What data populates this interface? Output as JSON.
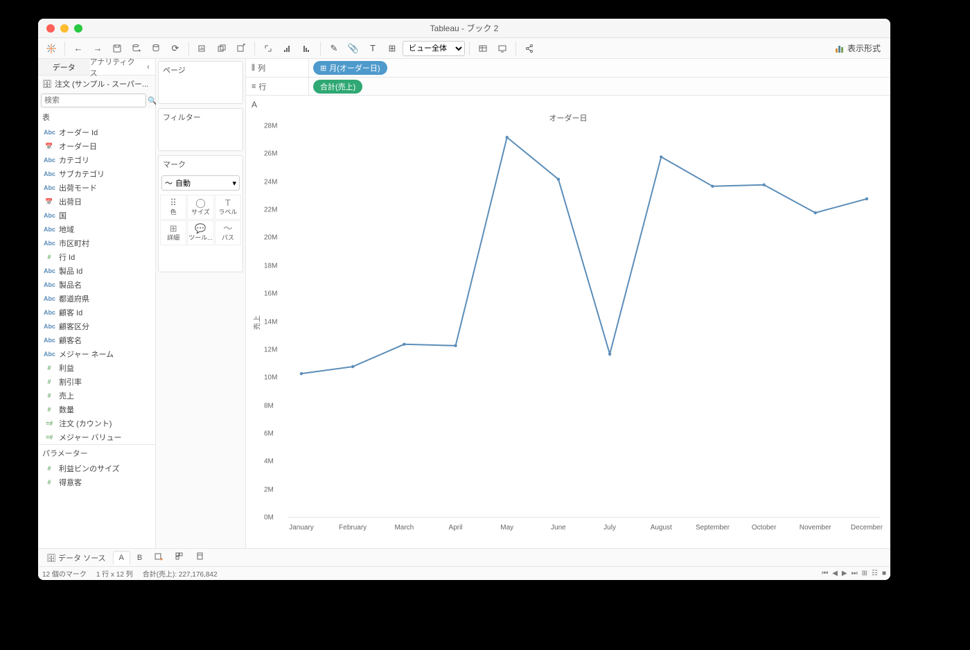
{
  "window": {
    "title": "Tableau - ブック 2"
  },
  "toolbar": {
    "fit_select": "ビュー全体",
    "showme_label": "表示形式"
  },
  "left": {
    "tabs": {
      "data": "データ",
      "analytics": "アナリティクス"
    },
    "datasource": "注文 (サンプル - スーパー...",
    "search_placeholder": "検索",
    "table_header": "表",
    "fields": [
      {
        "icon": "abc",
        "label": "オーダー Id"
      },
      {
        "icon": "date",
        "label": "オーダー日"
      },
      {
        "icon": "abc",
        "label": "カテゴリ"
      },
      {
        "icon": "abc",
        "label": "サブカテゴリ"
      },
      {
        "icon": "abc",
        "label": "出荷モード"
      },
      {
        "icon": "date",
        "label": "出荷日"
      },
      {
        "icon": "abc",
        "label": "国"
      },
      {
        "icon": "abc",
        "label": "地域"
      },
      {
        "icon": "abc",
        "label": "市区町村"
      },
      {
        "icon": "num",
        "label": "行 Id"
      },
      {
        "icon": "abc",
        "label": "製品 Id"
      },
      {
        "icon": "abc",
        "label": "製品名"
      },
      {
        "icon": "abc",
        "label": "都道府県"
      },
      {
        "icon": "abc",
        "label": "顧客 Id"
      },
      {
        "icon": "abc",
        "label": "顧客区分"
      },
      {
        "icon": "abc",
        "label": "顧客名"
      },
      {
        "icon": "abc",
        "label": "メジャー ネーム"
      },
      {
        "icon": "num",
        "label": "利益"
      },
      {
        "icon": "num",
        "label": "割引率"
      },
      {
        "icon": "num",
        "label": "売上"
      },
      {
        "icon": "num",
        "label": "数量"
      },
      {
        "icon": "numi",
        "label": "注文 (カウント)"
      },
      {
        "icon": "numi",
        "label": "メジャー バリュー"
      }
    ],
    "param_header": "パラメーター",
    "params": [
      {
        "label": "利益ビンのサイズ"
      },
      {
        "label": "得意客"
      }
    ]
  },
  "cards": {
    "pages": "ページ",
    "filters": "フィルター",
    "marks": "マーク",
    "marktype": "自動",
    "cells": {
      "color": "色",
      "size": "サイズ",
      "label": "ラベル",
      "detail": "詳細",
      "tooltip": "ツール...",
      "path": "パス"
    }
  },
  "shelves": {
    "columns_label": "列",
    "rows_label": "行",
    "column_pill": "月(オーダー日)",
    "row_pill": "合計(売上)"
  },
  "viz": {
    "corner": "A",
    "chart_title": "オーダー日",
    "ylabel": "売上"
  },
  "chart_data": {
    "type": "line",
    "categories": [
      "January",
      "February",
      "March",
      "April",
      "May",
      "June",
      "July",
      "August",
      "September",
      "October",
      "November",
      "December"
    ],
    "values": [
      10300000,
      10800000,
      12400000,
      12300000,
      27200000,
      24200000,
      11700000,
      25800000,
      23700000,
      23800000,
      21800000,
      22800000
    ],
    "xlabel": "",
    "ylabel": "売上",
    "ylim": [
      0,
      28000000
    ],
    "yticks": [
      0,
      2000000,
      4000000,
      6000000,
      8000000,
      10000000,
      12000000,
      14000000,
      16000000,
      18000000,
      20000000,
      22000000,
      24000000,
      26000000,
      28000000
    ],
    "ytick_labels": [
      "0M",
      "2M",
      "4M",
      "6M",
      "8M",
      "10M",
      "12M",
      "14M",
      "16M",
      "18M",
      "20M",
      "22M",
      "24M",
      "26M",
      "28M"
    ]
  },
  "bottom": {
    "datasource": "データ ソース",
    "sheet_a": "A",
    "sheet_b": "B"
  },
  "status": {
    "marks": "12 個のマーク",
    "dims": "1 行 x 12 列",
    "sum": "合計(売上): 227,176,842"
  }
}
